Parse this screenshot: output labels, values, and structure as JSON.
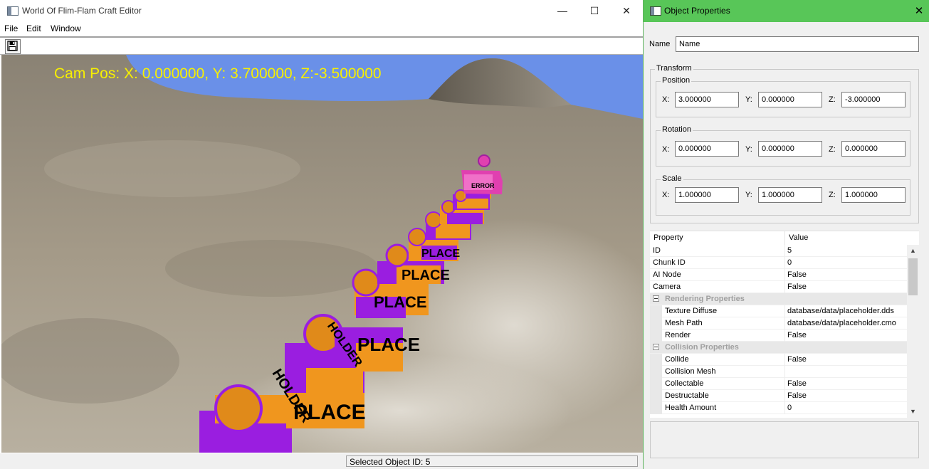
{
  "main_window": {
    "title": "World Of Flim-Flam Craft Editor",
    "minimize_glyph": "—",
    "maximize_glyph": "☐",
    "close_glyph": "✕",
    "menu": [
      "File",
      "Edit",
      "Window"
    ],
    "toolbar": {
      "save_icon": "save-icon"
    }
  },
  "viewport": {
    "cam_pos_text": "Cam Pos: X: 0.000000, Y: 3.700000, Z:-3.500000",
    "block_texts": [
      "PLACE",
      "HOLDER",
      "ACE",
      "ERROR"
    ],
    "colors": {
      "sky": "#6a90e8",
      "ground": "#a89e8c",
      "cam_text": "#f7f000",
      "block_purple": "#9a1ee0",
      "block_orange": "#f0961e",
      "block_pink": "#e040b0"
    }
  },
  "status_bar": {
    "selected_object": "Selected Object ID: 5"
  },
  "properties_window": {
    "title": "Object Properties",
    "close_glyph": "✕",
    "name_label": "Name",
    "name_value": "Name",
    "transform_label": "Transform",
    "position": {
      "label": "Position",
      "x_label": "X:",
      "y_label": "Y:",
      "z_label": "Z:",
      "x": "3.000000",
      "y": "0.000000",
      "z": "-3.000000"
    },
    "rotation": {
      "label": "Rotation",
      "x_label": "X:",
      "y_label": "Y:",
      "z_label": "Z:",
      "x": "0.000000",
      "y": "0.000000",
      "z": "0.000000"
    },
    "scale": {
      "label": "Scale",
      "x_label": "X:",
      "y_label": "Y:",
      "z_label": "Z:",
      "x": "1.000000",
      "y": "1.000000",
      "z": "1.000000"
    },
    "grid": {
      "header": {
        "property": "Property",
        "value": "Value"
      },
      "rows": [
        {
          "key": "ID",
          "value": "5",
          "type": "top"
        },
        {
          "key": "Chunk ID",
          "value": "0",
          "type": "top"
        },
        {
          "key": "AI Node",
          "value": "False",
          "type": "top"
        },
        {
          "key": "Camera",
          "value": "False",
          "type": "top"
        },
        {
          "key": "Rendering Properties",
          "value": "",
          "type": "category"
        },
        {
          "key": "Texture Diffuse",
          "value": "database/data/placeholder.dds",
          "type": "child"
        },
        {
          "key": "Mesh Path",
          "value": "database/data/placeholder.cmo",
          "type": "child"
        },
        {
          "key": "Render",
          "value": "False",
          "type": "child"
        },
        {
          "key": "Collision Properties",
          "value": "",
          "type": "category"
        },
        {
          "key": "Collide",
          "value": "False",
          "type": "child"
        },
        {
          "key": "Collision Mesh",
          "value": "",
          "type": "child"
        },
        {
          "key": "Collectable",
          "value": "False",
          "type": "child"
        },
        {
          "key": "Destructable",
          "value": "False",
          "type": "child"
        },
        {
          "key": "Health Amount",
          "value": "0",
          "type": "child"
        }
      ],
      "scroll_up_glyph": "▲",
      "scroll_down_glyph": "▼"
    }
  }
}
